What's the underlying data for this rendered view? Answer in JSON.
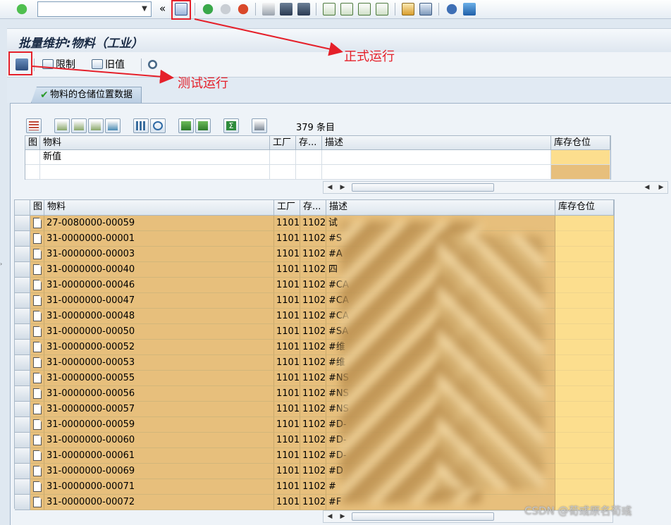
{
  "toolbar": {
    "command_placeholder": "",
    "double_chevron": "«"
  },
  "page_title": "批量维护:物料（工业）",
  "app_toolbar": {
    "limit_label": "限制",
    "old_value_label": "旧值"
  },
  "tab": {
    "label": "物料的仓储位置数据"
  },
  "count_text": "379 条目",
  "upper_grid": {
    "headers": [
      "图",
      "物料",
      "工厂",
      "存...",
      "描述",
      "库存仓位"
    ],
    "new_value_label": "新值"
  },
  "main_grid": {
    "headers": [
      "图",
      "物料",
      "工厂",
      "存...",
      "描述",
      "库存仓位"
    ],
    "rows": [
      {
        "material": "27-0080000-00059",
        "plant": "1101",
        "storage": "1102",
        "desc": "试"
      },
      {
        "material": "31-0000000-00001",
        "plant": "1101",
        "storage": "1102",
        "desc": "#S"
      },
      {
        "material": "31-0000000-00003",
        "plant": "1101",
        "storage": "1102",
        "desc": "#A"
      },
      {
        "material": "31-0000000-00040",
        "plant": "1101",
        "storage": "1102",
        "desc": "四"
      },
      {
        "material": "31-0000000-00046",
        "plant": "1101",
        "storage": "1102",
        "desc": "#CA"
      },
      {
        "material": "31-0000000-00047",
        "plant": "1101",
        "storage": "1102",
        "desc": "#CA"
      },
      {
        "material": "31-0000000-00048",
        "plant": "1101",
        "storage": "1102",
        "desc": "#CA"
      },
      {
        "material": "31-0000000-00050",
        "plant": "1101",
        "storage": "1102",
        "desc": "#SA"
      },
      {
        "material": "31-0000000-00052",
        "plant": "1101",
        "storage": "1102",
        "desc": "#维"
      },
      {
        "material": "31-0000000-00053",
        "plant": "1101",
        "storage": "1102",
        "desc": "#维"
      },
      {
        "material": "31-0000000-00055",
        "plant": "1101",
        "storage": "1102",
        "desc": "#NS"
      },
      {
        "material": "31-0000000-00056",
        "plant": "1101",
        "storage": "1102",
        "desc": "#NS"
      },
      {
        "material": "31-0000000-00057",
        "plant": "1101",
        "storage": "1102",
        "desc": "#NS"
      },
      {
        "material": "31-0000000-00059",
        "plant": "1101",
        "storage": "1102",
        "desc": "#D-"
      },
      {
        "material": "31-0000000-00060",
        "plant": "1101",
        "storage": "1102",
        "desc": "#D-"
      },
      {
        "material": "31-0000000-00061",
        "plant": "1101",
        "storage": "1102",
        "desc": "#D-"
      },
      {
        "material": "31-0000000-00069",
        "plant": "1101",
        "storage": "1102",
        "desc": "#D"
      },
      {
        "material": "31-0000000-00071",
        "plant": "1101",
        "storage": "1102",
        "desc": "#"
      },
      {
        "material": "31-0000000-00072",
        "plant": "1101",
        "storage": "1102",
        "desc": "#F"
      }
    ]
  },
  "annotations": {
    "formal_run": "正式运行",
    "test_run": "测试运行"
  },
  "watermark": "CSDN @荀彧原名荀彧",
  "colors": {
    "row_orange": "#e7bf7c",
    "column_yellow": "#fcde8e",
    "annotation_red": "#e5202a"
  }
}
